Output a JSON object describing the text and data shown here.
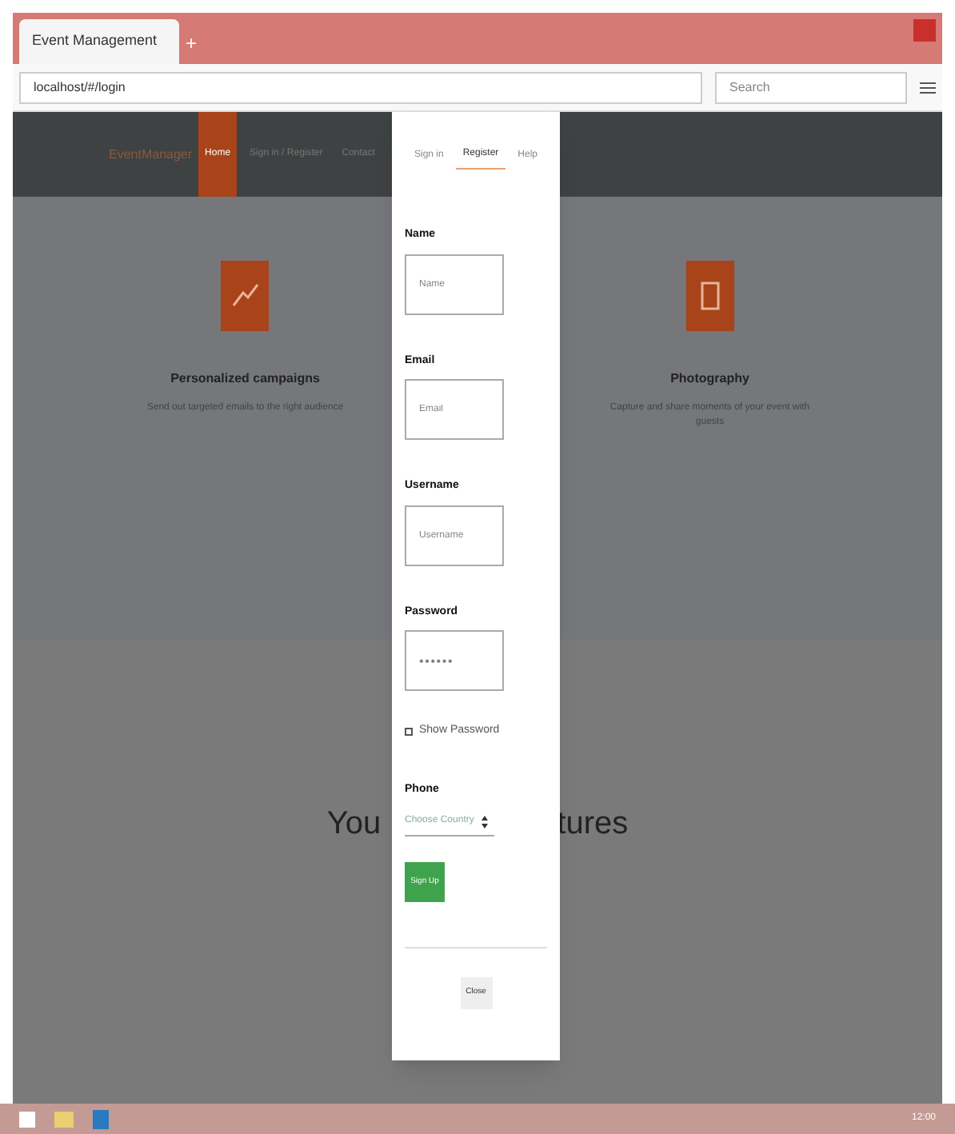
{
  "browser": {
    "tab_title": "Event Management",
    "new_tab": "+",
    "url": "localhost/#/login",
    "search_placeholder": "Search"
  },
  "navbar": {
    "brand": "EventManager",
    "links": [
      {
        "label": "Home",
        "selected": true
      },
      {
        "label": "Sign in / Register",
        "selected": false
      },
      {
        "label": "Contact",
        "selected": false
      }
    ]
  },
  "features": [
    {
      "kind": "chart",
      "title": "Personalized campaigns",
      "text": "Send out targeted emails to the right audience"
    },
    {
      "kind": "camera",
      "title": "Photography",
      "text": "Capture and share moments of your event with guests"
    }
  ],
  "section_heading_left": "You",
  "section_heading_right": "tures",
  "modal": {
    "tabs": [
      {
        "label": "Sign in",
        "selected": false
      },
      {
        "label": "Register",
        "selected": true
      },
      {
        "label": "Help",
        "selected": false
      }
    ],
    "fields": [
      {
        "kind": "text",
        "label": "Name",
        "placeholder": "Name"
      },
      {
        "kind": "text",
        "label": "Email",
        "placeholder": "Email"
      },
      {
        "kind": "text",
        "label": "Username",
        "placeholder": "Username"
      },
      {
        "kind": "password",
        "label": "Password",
        "placeholder": "••••••"
      }
    ],
    "show_password": "Show Password",
    "show_password_checked": false,
    "phone": {
      "label": "Phone",
      "placeholder": "Choose Country"
    },
    "submit": "Sign Up",
    "close": "Close"
  },
  "taskbar": {
    "clock": "12:00"
  }
}
